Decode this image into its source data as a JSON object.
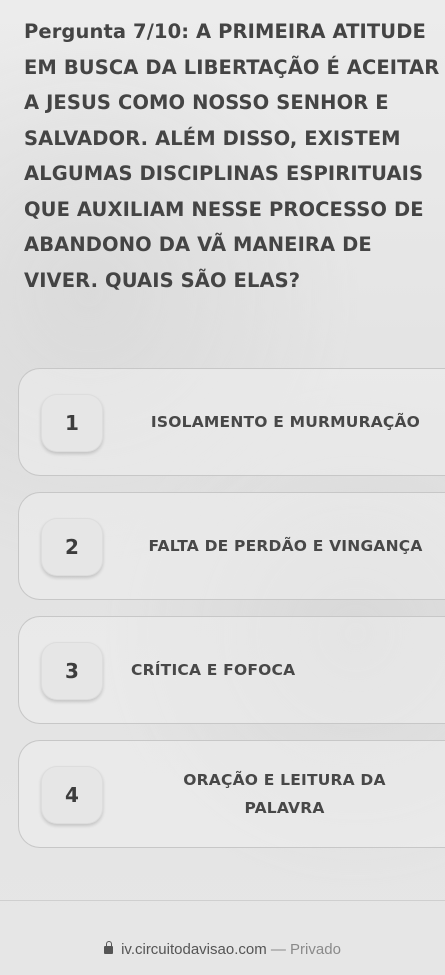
{
  "question": {
    "prefix": "Pergunta 7/10:",
    "text": "A PRIMEIRA ATITUDE EM BUSCA DA LIBERTAÇÃO É ACEITAR A JESUS COMO NOSSO SENHOR E SALVADOR. ALÉM DISSO, EXISTEM ALGUMAS DISCIPLINAS ESPIRITUAIS QUE AUXILIAM NESSE PROCESSO DE ABANDONO DA VÃ MANEIRA DE VIVER. QUAIS SÃO ELAS?"
  },
  "options": [
    {
      "number": "1",
      "label": "ISOLAMENTO E MURMURAÇÃO"
    },
    {
      "number": "2",
      "label": "FALTA DE PERDÃO E VINGANÇA"
    },
    {
      "number": "3",
      "label": "CRÍTICA E FOFOCA"
    },
    {
      "number": "4",
      "label": "ORAÇÃO E LEITURA DA PALAVRA"
    }
  ],
  "browser_bar": {
    "lock_icon": "lock-icon",
    "url": "iv.circuitodavisao.com",
    "separator": "—",
    "privacy_label": "Privado"
  }
}
